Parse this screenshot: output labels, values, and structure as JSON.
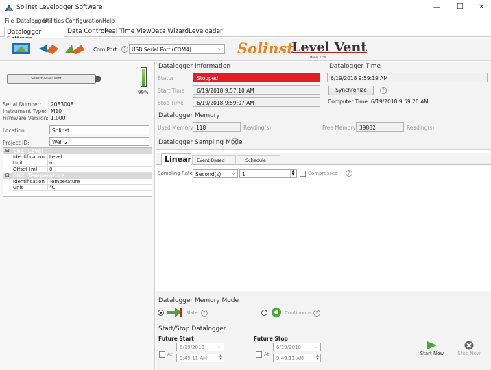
{
  "window": {
    "title": "Solinst Levelogger Software",
    "min": "—",
    "max": "☐",
    "close": "✕"
  },
  "menu": [
    "File",
    "Datalogger",
    "Utilities",
    "Configuration",
    "Help"
  ],
  "tabs": [
    "Datalogger Settings",
    "Data Control",
    "Real Time View",
    "Data Wizard",
    "Leveloader"
  ],
  "toolbar": {
    "com_label": "Com Port:",
    "com_value": "USB Serial Port (COM4)"
  },
  "brand": {
    "solinst": "Solinst",
    "product": "Level Vent",
    "model": "Model 3250"
  },
  "device": {
    "label_text": "Solinst Level Vent",
    "battery": "99%",
    "serial_label": "Serial Number:",
    "serial": "2083008",
    "type_label": "Instrument Type:",
    "type": "M10",
    "fw_label": "Firmware Version:",
    "fw": "1.000",
    "location_label": "Location:",
    "location": "Solinst",
    "project_label": "Project ID:",
    "project": "Well 2"
  },
  "channels": [
    {
      "name": "Ch1: Level",
      "rows": [
        [
          "Identification",
          "Level"
        ],
        [
          "Unit",
          "m"
        ],
        [
          "Offset (m)",
          "0"
        ]
      ]
    },
    {
      "name": "Ch2: Temperature",
      "rows": [
        [
          "Identification",
          "Temperature"
        ],
        [
          "Unit",
          "°C"
        ]
      ]
    }
  ],
  "info": {
    "title": "Datalogger Information",
    "status_label": "Status",
    "status": "Stopped",
    "start_label": "Start Time",
    "start": "6/19/2018 9:57:10 AM",
    "stop_label": "Stop Time",
    "stop": "6/19/2018 9:59:07 AM"
  },
  "time": {
    "title": "Datalogger Time",
    "value": "6/19/2018 9:59:19 AM",
    "sync": "Synchronize",
    "computer": "Computer Time: 6/19/2018 9:59:20 AM"
  },
  "memory": {
    "title": "Datalogger Memory",
    "used_label": "Used Memory",
    "used": "118",
    "used_unit": "Reading(s)",
    "free_label": "Free Memory",
    "free": "39882",
    "free_unit": "Reading(s)"
  },
  "sampling": {
    "title": "Datalogger Sampling Mode",
    "tabs": [
      "Linear",
      "Event Based",
      "Schedule"
    ],
    "rate_label": "Sampling Rate",
    "rate_unit": "Second(s)",
    "rate_value": "1",
    "compressed": "Compressed"
  },
  "mem_mode": {
    "title": "Datalogger Memory Mode",
    "slate": "Slate",
    "continuous": "Continuous"
  },
  "startstop": {
    "title": "Start/Stop Datalogger",
    "future_start": "Future Start",
    "future_stop": "Future Stop",
    "at": "At",
    "start_date": "6/19/2018",
    "start_time": "9:49:11 AM",
    "stop_date": "6/19/2018",
    "stop_time": "9:49:11 AM",
    "start_now": "Start Now",
    "stop_now": "Stop Now"
  }
}
